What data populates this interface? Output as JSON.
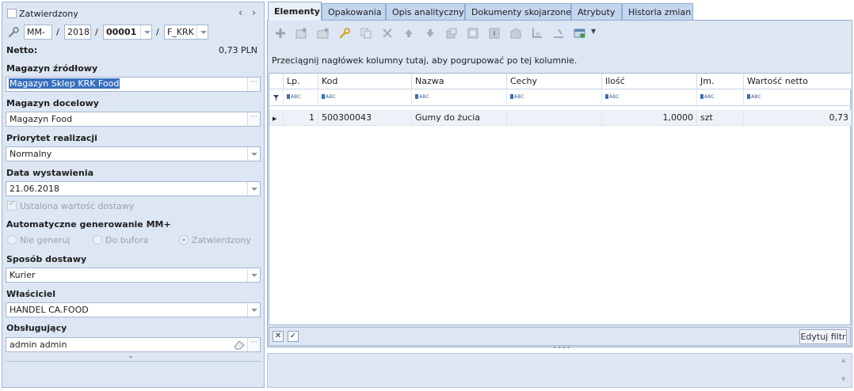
{
  "header": {
    "approved_label": "Zatwierdzony",
    "doc_prefix": "MM-",
    "doc_year": "2018",
    "doc_number": "00001",
    "doc_series": "F_KRK",
    "net_label": "Netto:",
    "net_value": "0,73 PLN"
  },
  "form": {
    "source_wh_label": "Magazyn źródłowy",
    "source_wh_value": "Magazyn Sklep KRK Food",
    "target_wh_label": "Magazyn docelowy",
    "target_wh_value": "Magazyn Food",
    "priority_label": "Priorytet realizacji",
    "priority_value": "Normalny",
    "issue_date_label": "Data wystawienia",
    "issue_date_value": "21.06.2018",
    "fixed_delivery_label": "Ustalona wartość dostawy",
    "auto_gen_label": "Automatyczne generowanie MM+",
    "auto_gen_options": [
      "Nie generuj",
      "Do bufora",
      "Zatwierdzony"
    ],
    "delivery_method_label": "Sposób dostawy",
    "delivery_method_value": "Kurier",
    "owner_label": "Właściciel",
    "owner_value": "HANDEL CA.FOOD",
    "handler_label": "Obsługujący",
    "handler_value": "admin admin"
  },
  "tabs": [
    "Elementy",
    "Opakowania",
    "Opis analityczny",
    "Dokumenty skojarzone",
    "Atrybuty",
    "Historia zmian"
  ],
  "grid": {
    "group_hint": "Przeciągnij nagłówek kolumny tutaj, aby pogrupować po tej kolumnie.",
    "columns": [
      "Lp.",
      "Kod",
      "Nazwa",
      "Cechy",
      "Ilość",
      "Jm.",
      "Wartość netto"
    ],
    "filter_placeholder": "ABC",
    "rows": [
      {
        "lp": "1",
        "kod": "500300043",
        "nazwa": "Gumy do żucia",
        "cechy": "",
        "ilosc": "1,0000",
        "jm": "szt",
        "wartosc": "0,73"
      }
    ],
    "edit_filter_label": "Edytuj filtr"
  },
  "colors": {
    "panel": "#dde6f3",
    "border": "#92acd3",
    "selection": "#3a70c0",
    "tab": "#c4d5ee"
  }
}
